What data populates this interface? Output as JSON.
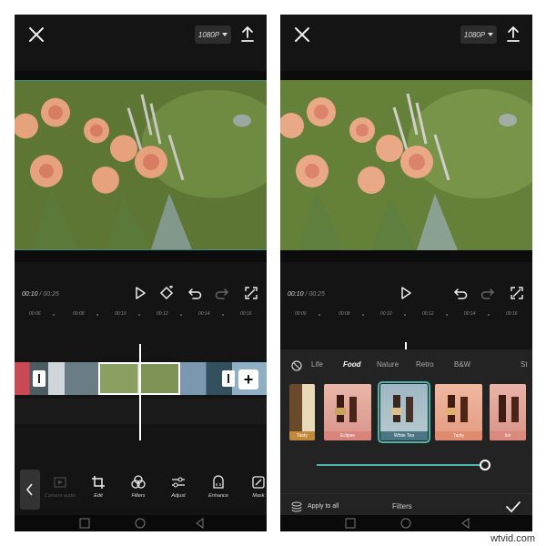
{
  "left_screen": {
    "resolution": "1080P",
    "timecode": {
      "current": "00:10",
      "separator": "/",
      "total": "00:25"
    },
    "ruler_ticks": [
      "00:06",
      "00:08",
      "00:10",
      "00:12",
      "00:14",
      "00:16"
    ],
    "toolbar": [
      {
        "label": "Camera audio",
        "icon": "camera-audio-icon",
        "dim": true
      },
      {
        "label": "Edit",
        "icon": "crop-icon"
      },
      {
        "label": "Filters",
        "icon": "filters-icon"
      },
      {
        "label": "Adjust",
        "icon": "adjust-sliders-icon"
      },
      {
        "label": "Enhance",
        "icon": "enhance-icon"
      },
      {
        "label": "Mask",
        "icon": "mask-icon"
      }
    ],
    "add_clip_label": "+"
  },
  "right_screen": {
    "resolution": "1080P",
    "timecode": {
      "current": "00:10",
      "separator": "/",
      "total": "00:25"
    },
    "ruler_ticks": [
      "00:06",
      "00:08",
      "00:10",
      "00:12",
      "00:14",
      "00:16"
    ],
    "filter_categories": [
      "Life",
      "Food",
      "Nature",
      "Retro",
      "B&W",
      "St"
    ],
    "active_category": "Food",
    "filter_thumbnails": [
      {
        "label": "Tasty",
        "selected": false
      },
      {
        "label": "Eclipse",
        "selected": false
      },
      {
        "label": "White Tea",
        "selected": true
      },
      {
        "label": "Tasty",
        "selected": false
      },
      {
        "label": "Ice",
        "selected": false
      }
    ],
    "filter_intensity": 1.0,
    "apply_all_label": "Apply to all",
    "panel_title": "Filters"
  },
  "watermark": "wtvid.com",
  "colors": {
    "accent": "#4db6ac",
    "background": "#141414",
    "panel": "#232323"
  }
}
